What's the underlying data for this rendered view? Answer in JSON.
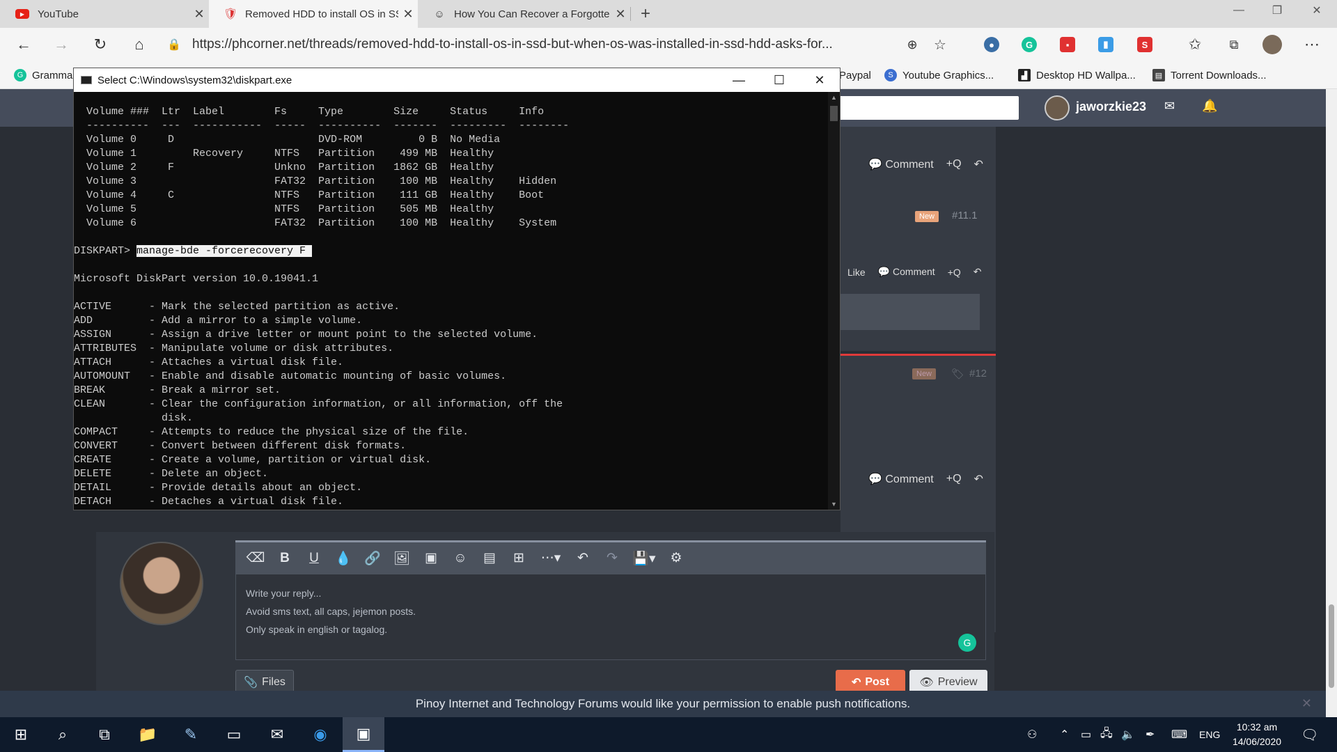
{
  "browser": {
    "tabs": [
      {
        "title": "YouTube",
        "favicon": "youtube-icon",
        "active": false
      },
      {
        "title": "Removed HDD to install OS in SS",
        "favicon": "phcorner-icon",
        "active": true
      },
      {
        "title": "How You Can Recover a Forgotte",
        "favicon": "page-icon",
        "active": false
      }
    ],
    "url": "https://phcorner.net/threads/removed-hdd-to-install-os-in-ssd-but-when-os-was-installed-in-ssd-hdd-asks-for...",
    "bookmarks": [
      {
        "label": "Gramma",
        "color": "#15c39a",
        "glyph": "G"
      },
      {
        "label": "Paypal",
        "color": "#003087",
        "glyph": "P"
      },
      {
        "label": "Youtube Graphics...",
        "color": "#3b6ed0",
        "glyph": "S"
      },
      {
        "label": "Desktop HD Wallpa...",
        "color": "#222222",
        "glyph": "▟"
      },
      {
        "label": "Torrent Downloads...",
        "color": "#444444",
        "glyph": "▤"
      }
    ]
  },
  "forum": {
    "username": "jaworzkie23",
    "post_actions": {
      "comment": "Comment",
      "quote": "+Q",
      "like": "Like"
    },
    "badge_new": "New",
    "post_numbers": [
      "#11.1",
      "#12"
    ],
    "editor": {
      "placeholder_lines": [
        "Write your reply...",
        "Avoid sms text, all caps, jejemon posts.",
        "Only speak in english or tagalog."
      ]
    },
    "buttons": {
      "files": "Files",
      "post": "Post",
      "preview": "Preview"
    },
    "push_message": "Pinoy Internet and Technology Forums would like your permission to enable push notifications."
  },
  "cmd": {
    "title": "Select C:\\Windows\\system32\\diskpart.exe",
    "lines": [
      "  Volume ###  Ltr  Label        Fs     Type        Size     Status     Info",
      "  ----------  ---  -----------  -----  ----------  -------  ---------  --------",
      "  Volume 0     D                       DVD-ROM         0 B  No Media",
      "  Volume 1         Recovery     NTFS   Partition    499 MB  Healthy",
      "  Volume 2     F                Unkno  Partition   1862 GB  Healthy",
      "  Volume 3                      FAT32  Partition    100 MB  Healthy    Hidden",
      "  Volume 4     C                NTFS   Partition    111 GB  Healthy    Boot",
      "  Volume 5                      NTFS   Partition    505 MB  Healthy",
      "  Volume 6                      FAT32  Partition    100 MB  Healthy    System",
      "",
      "__PROMPT__",
      "",
      "Microsoft DiskPart version 10.0.19041.1",
      "",
      "ACTIVE      - Mark the selected partition as active.",
      "ADD         - Add a mirror to a simple volume.",
      "ASSIGN      - Assign a drive letter or mount point to the selected volume.",
      "ATTRIBUTES  - Manipulate volume or disk attributes.",
      "ATTACH      - Attaches a virtual disk file.",
      "AUTOMOUNT   - Enable and disable automatic mounting of basic volumes.",
      "BREAK       - Break a mirror set.",
      "CLEAN       - Clear the configuration information, or all information, off the",
      "              disk.",
      "COMPACT     - Attempts to reduce the physical size of the file.",
      "CONVERT     - Convert between different disk formats.",
      "CREATE      - Create a volume, partition or virtual disk.",
      "DELETE      - Delete an object.",
      "DETAIL      - Provide details about an object.",
      "DETACH      - Detaches a virtual disk file."
    ],
    "prompt": "DISKPART> ",
    "command": "manage-bde -forcerecovery F "
  },
  "taskbar": {
    "language": "ENG",
    "time": "10:32 am",
    "date": "14/06/2020"
  }
}
